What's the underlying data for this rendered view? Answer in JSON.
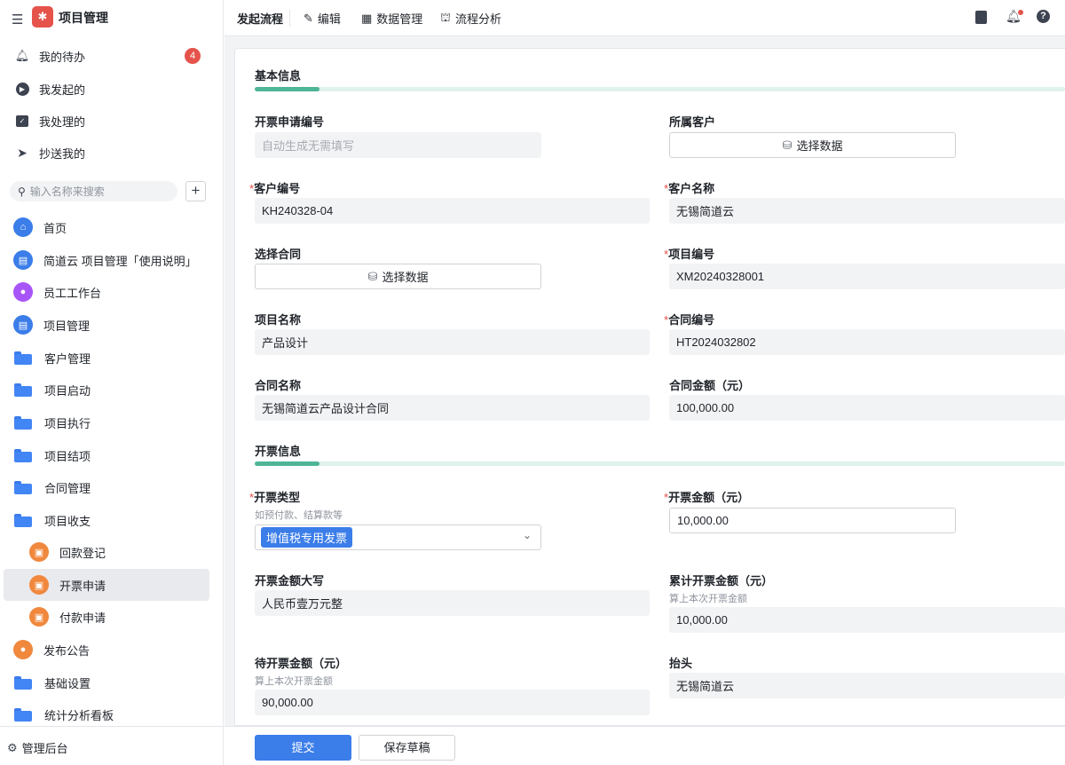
{
  "app": {
    "title": "项目管理",
    "logo_color": "#e5534b"
  },
  "sidebar": {
    "top": [
      {
        "label": "我的待办",
        "badge": "4",
        "icon": "bell-icon"
      },
      {
        "label": "我发起的",
        "icon": "play-circle-icon"
      },
      {
        "label": "我处理的",
        "icon": "inbox-check-icon"
      },
      {
        "label": "抄送我的",
        "icon": "paper-plane-icon"
      }
    ],
    "search_placeholder": "输入名称来搜索",
    "items": [
      {
        "label": "首页",
        "icon": "home-icon"
      },
      {
        "label": "简道云 项目管理「使用说明」",
        "icon": "document-icon"
      },
      {
        "label": "员工工作台",
        "icon": "user-icon"
      },
      {
        "label": "项目管理",
        "icon": "document-icon"
      },
      {
        "label": "客户管理",
        "icon": "folder-icon"
      },
      {
        "label": "项目启动",
        "icon": "folder-icon"
      },
      {
        "label": "项目执行",
        "icon": "folder-icon"
      },
      {
        "label": "项目结项",
        "icon": "folder-icon"
      },
      {
        "label": "合同管理",
        "icon": "folder-icon"
      },
      {
        "label": "项目收支",
        "icon": "folder-icon"
      },
      {
        "label": "回款登记",
        "icon": "workflow-form-icon"
      },
      {
        "label": "开票申请",
        "icon": "workflow-form-icon",
        "selected": true
      },
      {
        "label": "付款申请",
        "icon": "workflow-form-icon"
      },
      {
        "label": "发布公告",
        "icon": "announcement-icon"
      },
      {
        "label": "基础设置",
        "icon": "folder-icon"
      },
      {
        "label": "统计分析看板",
        "icon": "folder-icon"
      }
    ],
    "admin": "管理后台"
  },
  "topbar": {
    "tabs": [
      "发起流程",
      "编辑",
      "数据管理",
      "流程分析"
    ]
  },
  "form": {
    "section1": "基本信息",
    "section2": "开票信息",
    "select_data": "选择数据",
    "fields": {
      "apply_no": {
        "label": "开票申请编号",
        "placeholder": "自动生成无需填写"
      },
      "customer": {
        "label": "所属客户"
      },
      "customer_no": {
        "label": "客户编号",
        "value": "KH240328-04"
      },
      "customer_name": {
        "label": "客户名称",
        "value": "无锡简道云"
      },
      "contract_select": {
        "label": "选择合同"
      },
      "project_no": {
        "label": "项目编号",
        "value": "XM20240328001"
      },
      "project_name": {
        "label": "项目名称",
        "value": "产品设计"
      },
      "contract_no": {
        "label": "合同编号",
        "value": "HT2024032802"
      },
      "contract_name": {
        "label": "合同名称",
        "value": "无锡简道云产品设计合同"
      },
      "contract_amount": {
        "label": "合同金额（元）",
        "value": "100,000.00"
      },
      "invoice_type": {
        "label": "开票类型",
        "hint": "如预付款、结算款等",
        "value": "增值税专用发票"
      },
      "invoice_amount": {
        "label": "开票金额（元）",
        "value": "10,000.00"
      },
      "amount_upper": {
        "label": "开票金额大写",
        "value": "人民币壹万元整"
      },
      "total_amount": {
        "label": "累计开票金额（元）",
        "hint": "算上本次开票金额",
        "value": "10,000.00"
      },
      "pending_amount": {
        "label": "待开票金额（元）",
        "hint": "算上本次开票金额",
        "value": "90,000.00"
      },
      "title": {
        "label": "抬头",
        "value": "无锡简道云"
      }
    }
  },
  "footer": {
    "submit": "提交",
    "save_draft": "保存草稿"
  },
  "colors": {
    "primary": "#3b7de9",
    "accent": "#4eb596",
    "badge": "#e5534b"
  }
}
